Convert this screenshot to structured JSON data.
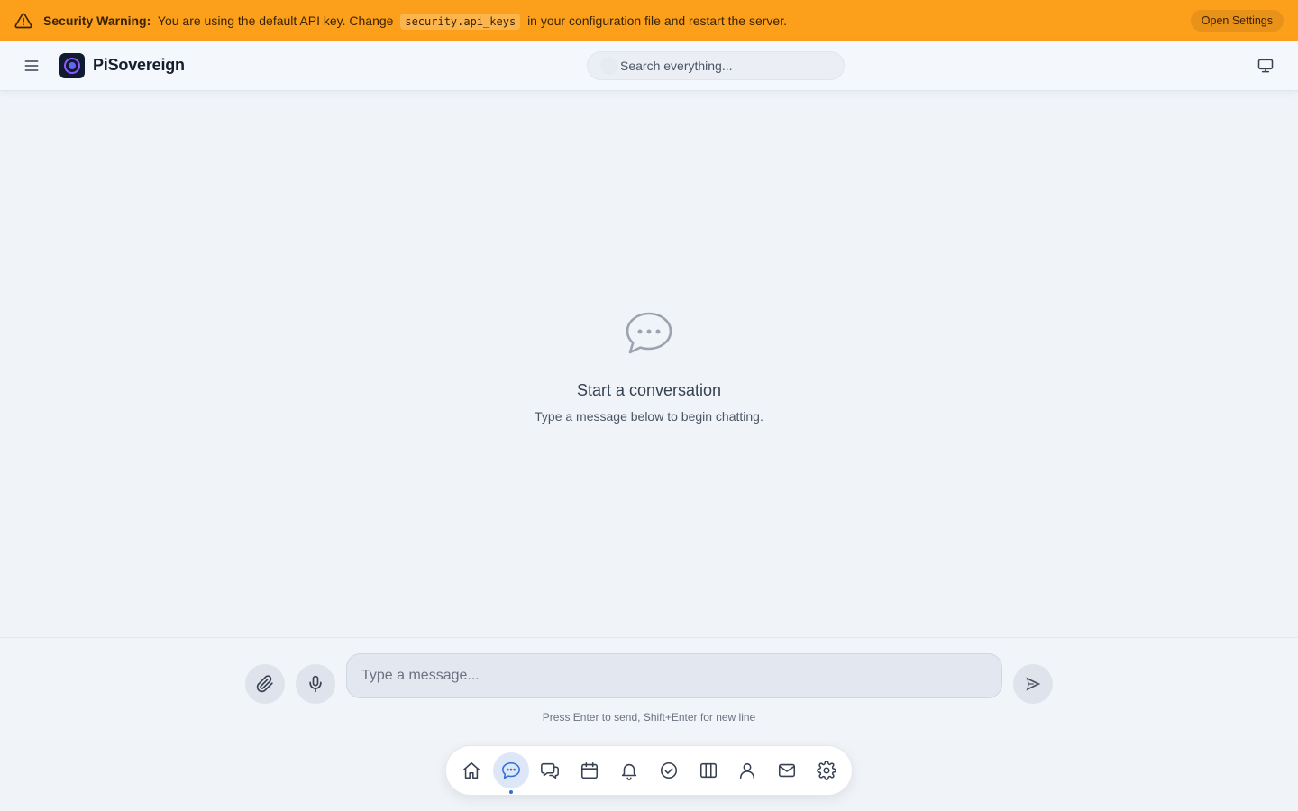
{
  "banner": {
    "title": "Security Warning:",
    "text_before": "You are using the default API key. Change",
    "code": "security.api_keys",
    "text_after": "in your configuration file and restart the server.",
    "button_label": "Open Settings",
    "color": "#fca01c"
  },
  "header": {
    "brand": "PiSovereign",
    "search_placeholder": "Search everything..."
  },
  "empty_state": {
    "title": "Start a conversation",
    "subtitle": "Type a message below to begin chatting."
  },
  "composer": {
    "placeholder": "Type a message...",
    "hint": "Press Enter to send, Shift+Enter for new line"
  },
  "dock": {
    "active": "chat",
    "items": [
      "home-icon",
      "chat-icon",
      "conversations-icon",
      "calendar-icon",
      "bell-icon",
      "check-circle-icon",
      "columns-icon",
      "user-icon",
      "mail-icon",
      "gear-icon"
    ]
  },
  "colors": {
    "accent": "#2f6fd6",
    "background": "#f0f4f9"
  }
}
